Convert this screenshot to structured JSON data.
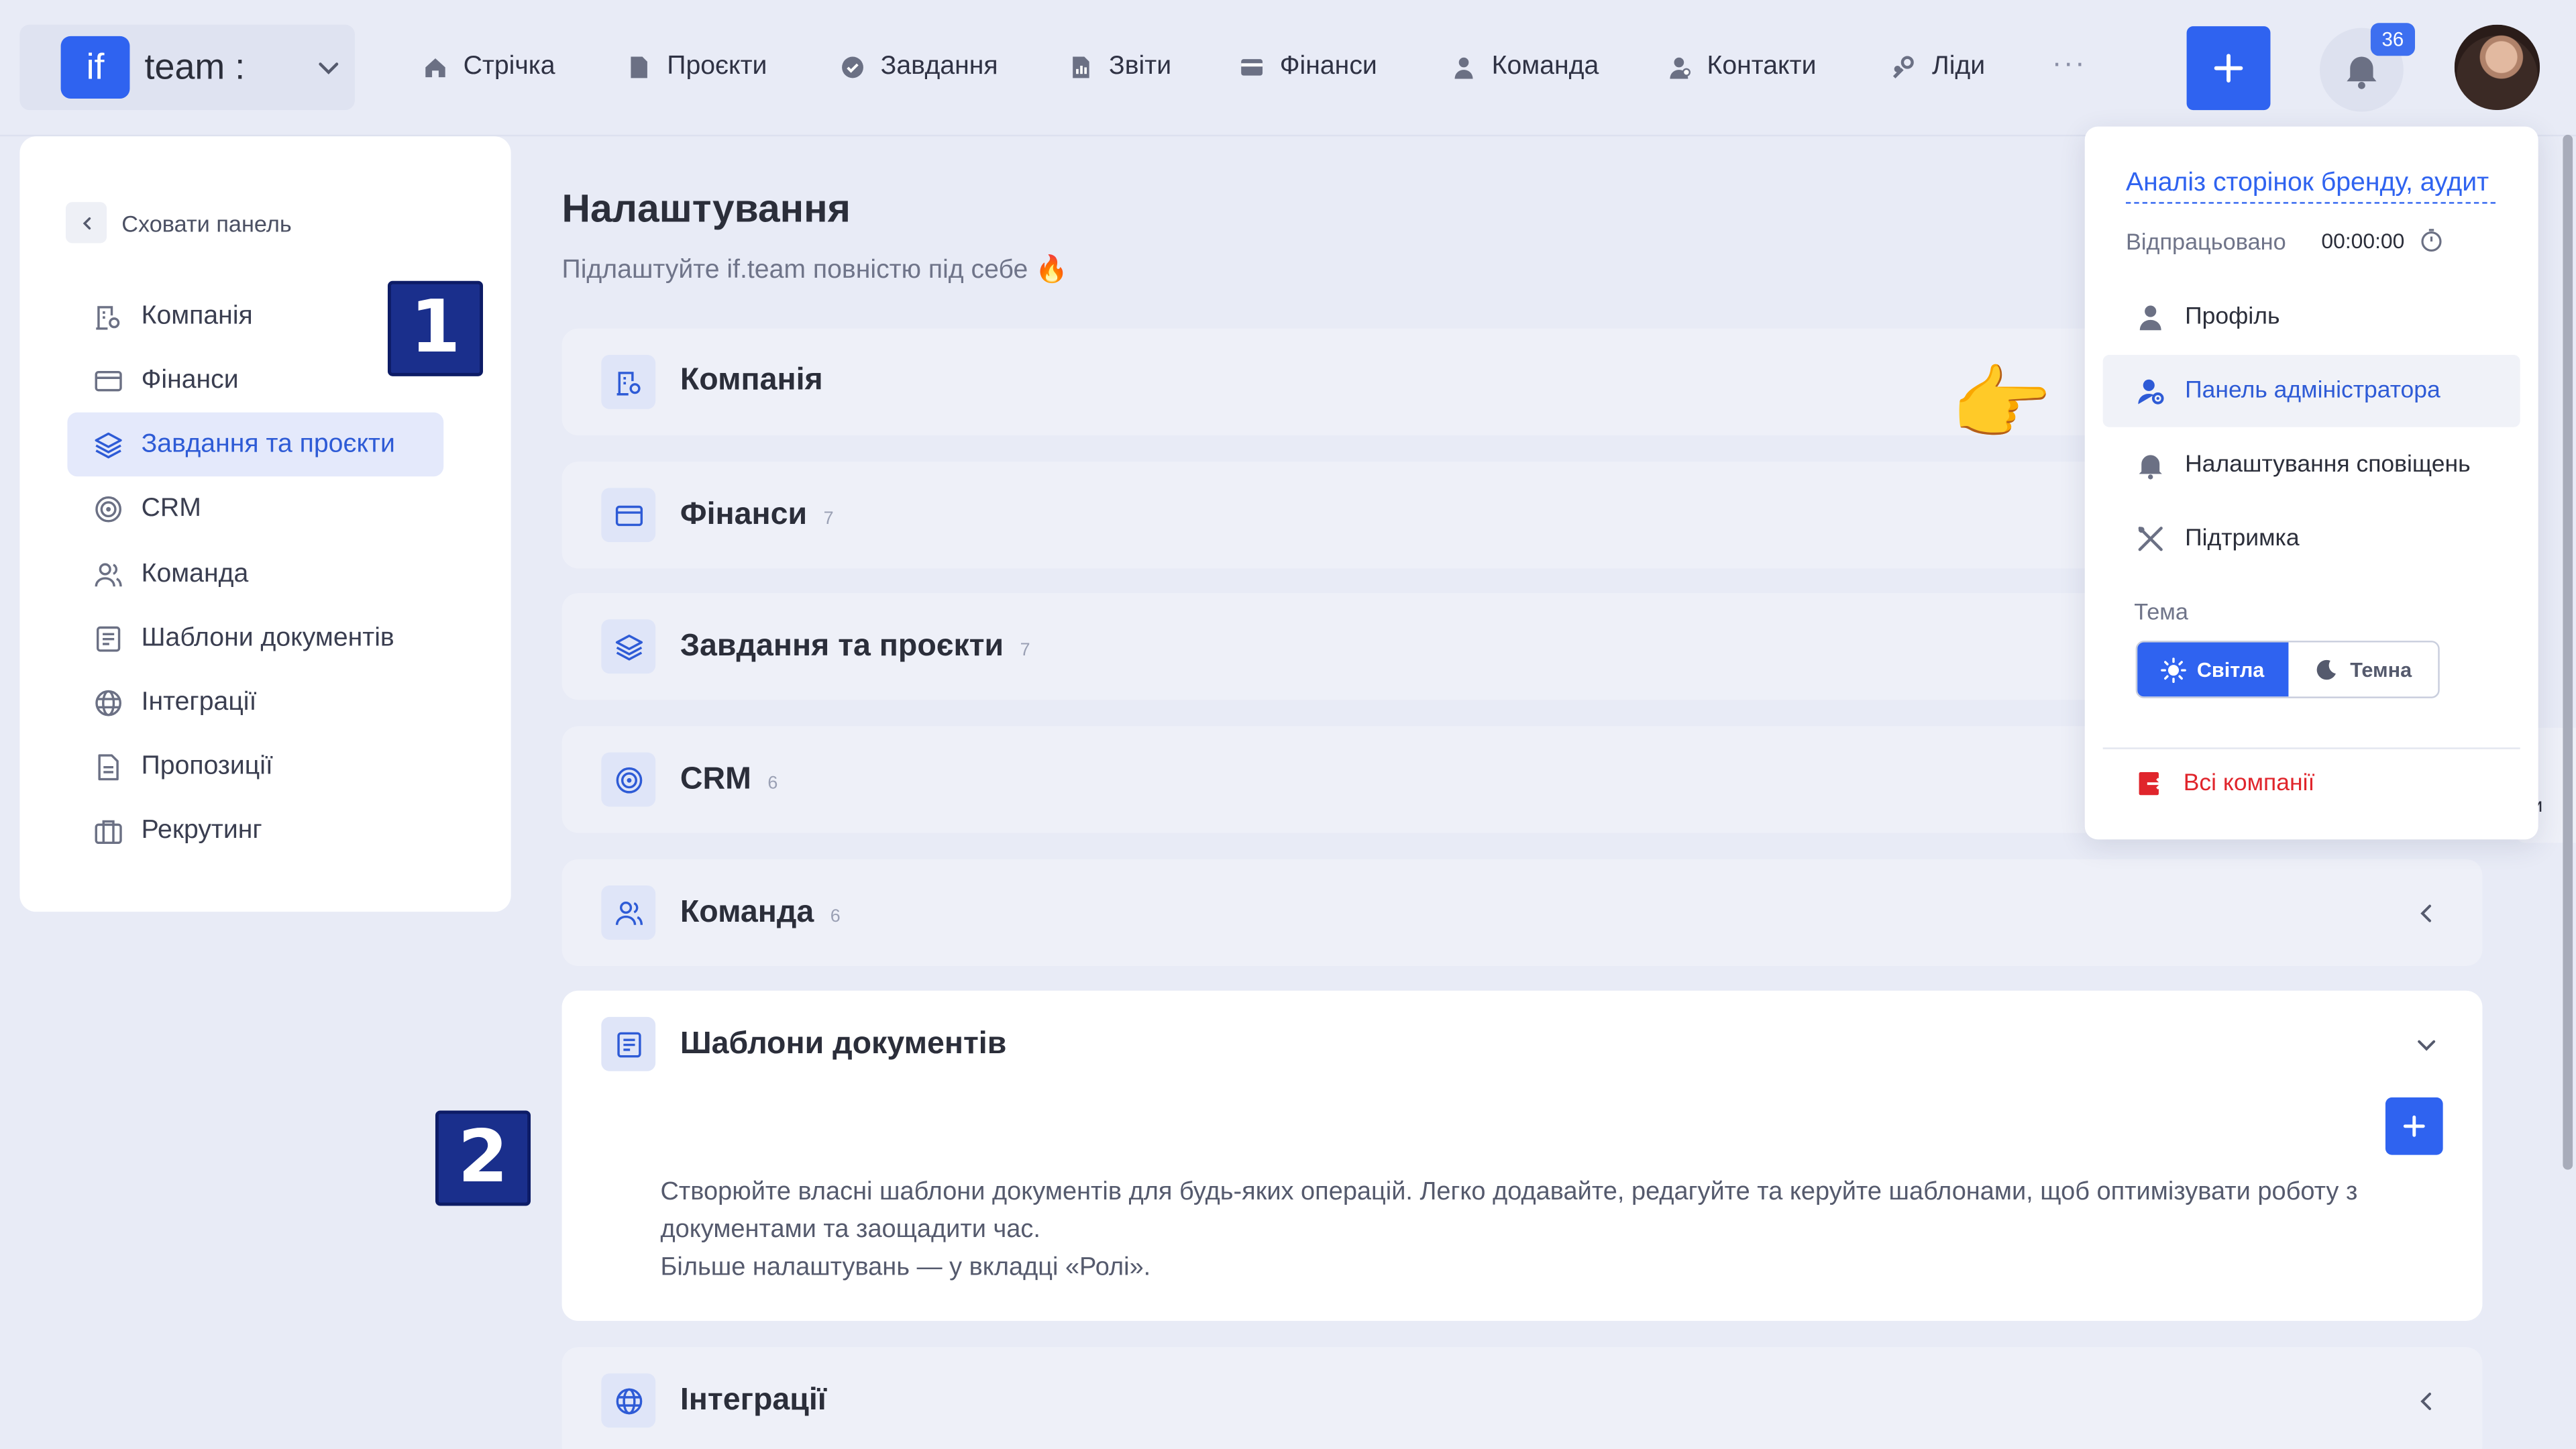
{
  "topbar": {
    "brand_logo": "if",
    "brand_name": "team :",
    "nav": [
      "Стрічка",
      "Проєкти",
      "Завдання",
      "Звіти",
      "Фінанси",
      "Команда",
      "Контакти",
      "Ліди"
    ],
    "more": "···",
    "notifications_count": "36",
    "accent_color": "#2f63f0"
  },
  "sidebar": {
    "hide_label": "Сховати панель",
    "items": [
      {
        "label": "Компанія",
        "icon": "building-gear-icon",
        "active": false
      },
      {
        "label": "Фінанси",
        "icon": "credit-card-icon",
        "active": false
      },
      {
        "label": "Завдання та проєкти",
        "icon": "layers-icon",
        "active": true
      },
      {
        "label": "CRM",
        "icon": "target-icon",
        "active": false
      },
      {
        "label": "Команда",
        "icon": "users-icon",
        "active": false
      },
      {
        "label": "Шаблони документів",
        "icon": "document-list-icon",
        "active": false
      },
      {
        "label": "Інтеграції",
        "icon": "globe-icon",
        "active": false
      },
      {
        "label": "Пропозиції",
        "icon": "document-icon",
        "active": false
      },
      {
        "label": "Рекрутинг",
        "icon": "briefcase-icon",
        "active": false
      }
    ]
  },
  "markers": {
    "one": "1",
    "two": "2"
  },
  "main": {
    "title": "Налаштування",
    "subtitle": "Підлаштуйте if.team повністю під себе 🔥",
    "sections": [
      {
        "title": "Компанія",
        "count": ""
      },
      {
        "title": "Фінанси",
        "count": "7"
      },
      {
        "title": "Завдання та проєкти",
        "count": "7"
      },
      {
        "title": "CRM",
        "count": "6"
      },
      {
        "title": "Команда",
        "count": "6"
      },
      {
        "title": "Шаблони документів",
        "count": "",
        "description": "Створюйте власні шаблони документів для будь-яких операцій. Легко додавайте, редагуйте та керуйте шаблонами, щоб оптимізувати роботу з документами та заощадити час.",
        "description2": "Більше налаштувань — у вкладці «Ролі»."
      },
      {
        "title": "Інтеграції",
        "count": ""
      }
    ]
  },
  "dropdown": {
    "current_task": "Аналіз сторінок бренду, аудит",
    "worked_label": "Відпрацьовано",
    "worked_time": "00:00:00",
    "items": [
      "Профіль",
      "Панель адміністратора",
      "Налаштування сповіщень",
      "Підтримка"
    ],
    "theme_label": "Тема",
    "theme_light": "Світла",
    "theme_dark": "Темна",
    "exit_label": "Всі компанії",
    "danger_color": "#e0252c"
  },
  "pointer_emoji": "👉",
  "peek_text": "и"
}
